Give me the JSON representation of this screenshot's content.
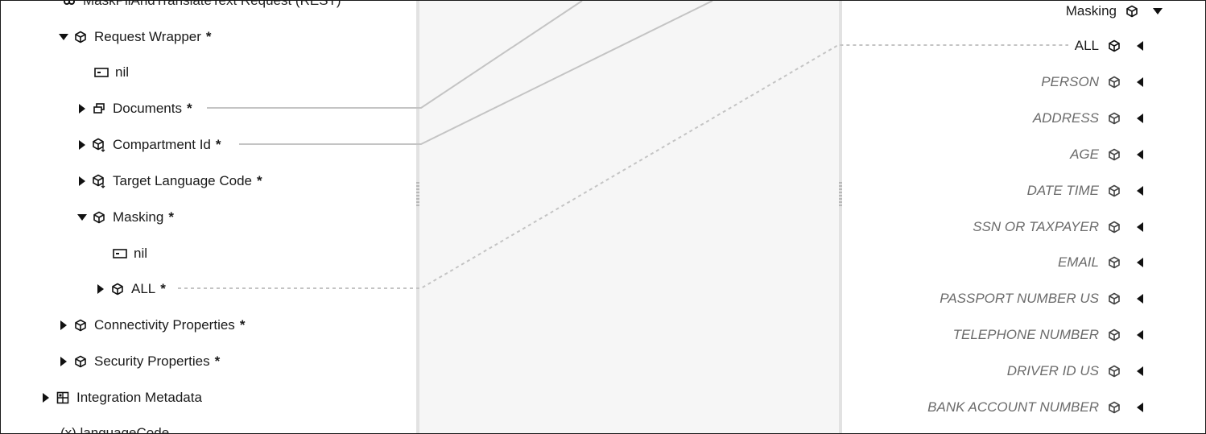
{
  "left_tree": {
    "root_label": "MaskPiiAndTranslateText Request (REST)",
    "request_wrapper": "Request Wrapper",
    "nil_1": "nil",
    "documents": "Documents",
    "compartment_id": "Compartment Id",
    "target_language_code": "Target Language Code",
    "masking": "Masking",
    "nil_2": "nil",
    "all": "ALL",
    "connectivity_properties": "Connectivity Properties",
    "security_properties": "Security Properties",
    "integration_metadata": "Integration Metadata",
    "language_code": "(x) languageCode",
    "required_marker": "*"
  },
  "right_tree": {
    "masking": "Masking",
    "items": [
      "ALL",
      "PERSON",
      "ADDRESS",
      "AGE",
      "DATE TIME",
      "SSN OR TAXPAYER",
      "EMAIL",
      "PASSPORT NUMBER US",
      "TELEPHONE NUMBER",
      "DRIVER ID US",
      "BANK ACCOUNT NUMBER"
    ]
  },
  "icons": {
    "object": "cube-icon",
    "field": "field-icon",
    "collection": "collection-icon",
    "metadata": "metadata-icon"
  },
  "colors": {
    "mapping_line": "#c4c4c4",
    "center_panel": "#f6f6f6",
    "divider": "#e2e2e2"
  }
}
